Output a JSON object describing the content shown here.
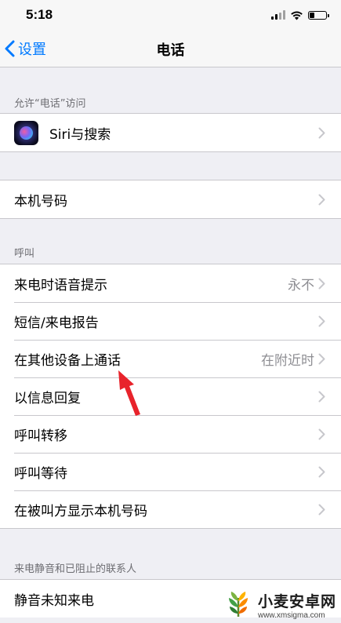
{
  "status_bar": {
    "time": "5:18",
    "battery_level": 0.3
  },
  "nav": {
    "back_label": "设置",
    "title": "电话"
  },
  "sections": {
    "access_header": "允许“电话”访问",
    "siri_label": "Siri与搜索",
    "my_number_label": "本机号码",
    "calls_header": "呼叫",
    "calls": [
      {
        "label": "来电时语音提示",
        "value": "永不"
      },
      {
        "label": "短信/来电报告",
        "value": ""
      },
      {
        "label": "在其他设备上通话",
        "value": "在附近时"
      },
      {
        "label": "以信息回复",
        "value": ""
      },
      {
        "label": "呼叫转移",
        "value": ""
      },
      {
        "label": "呼叫等待",
        "value": ""
      },
      {
        "label": "在被叫方显示本机号码",
        "value": ""
      }
    ],
    "silence_header": "来电静音和已阻止的联系人",
    "silence_label": "静音未知来电"
  },
  "watermark": {
    "brand": "小麦安卓网",
    "url": "www.xmsigma.com"
  },
  "colors": {
    "accent": "#007aff",
    "annotation": "#e8232b"
  }
}
